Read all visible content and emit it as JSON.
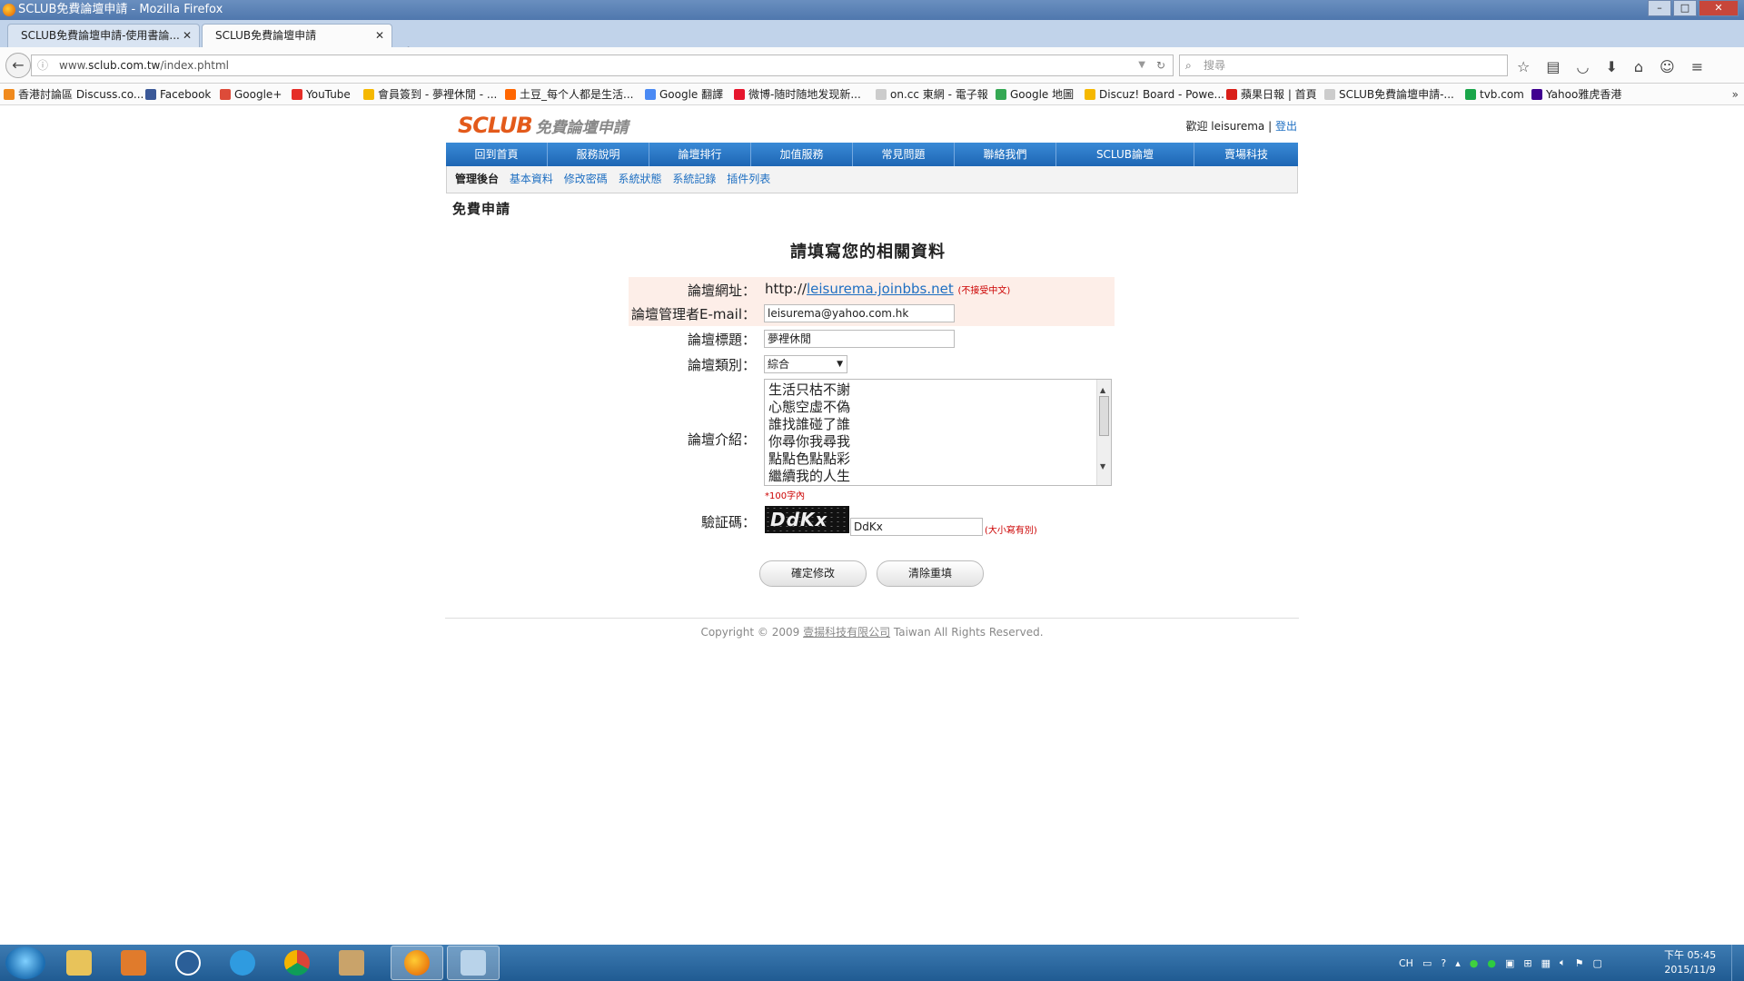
{
  "window": {
    "title": "SCLUB免費論壇申請 - Mozilla Firefox"
  },
  "browser": {
    "tabs": [
      {
        "label": "SCLUB免費論壇申請-使用書論..."
      },
      {
        "label": "SCLUB免費論壇申請"
      }
    ],
    "url_prefix": "www.",
    "url_host": "sclub.com.tw",
    "url_path": "/index.phtml",
    "search_placeholder": "搜尋",
    "bookmarks": [
      {
        "label": "香港討論區 Discuss.co...",
        "color": "#f08a1d"
      },
      {
        "label": "Facebook",
        "color": "#3b5998"
      },
      {
        "label": "Google+",
        "color": "#dd4b39"
      },
      {
        "label": "YouTube",
        "color": "#e52d27"
      },
      {
        "label": "會員簽到 - 夢裡休閒 - ...",
        "color": "#f5b800"
      },
      {
        "label": "土豆_每个人都是生活...",
        "color": "#ff6600"
      },
      {
        "label": "Google 翻譯",
        "color": "#4a8af4"
      },
      {
        "label": "微博-随时随地发现新...",
        "color": "#e6162d"
      },
      {
        "label": "on.cc 東網 - 電子報",
        "color": "#cccccc"
      },
      {
        "label": "Google 地圖",
        "color": "#34a853"
      },
      {
        "label": "Discuz! Board - Powe...",
        "color": "#f5b800"
      },
      {
        "label": "蘋果日報 | 首頁",
        "color": "#d91e18"
      },
      {
        "label": "SCLUB免費論壇申請-...",
        "color": "#cccccc"
      },
      {
        "label": "tvb.com",
        "color": "#1aa64a"
      },
      {
        "label": "Yahoo雅虎香港",
        "color": "#400090"
      }
    ]
  },
  "site": {
    "logo": "SCLUB",
    "logo_sub": "免費論壇申請",
    "welcome": "歡迎 leisurema |",
    "logout": "登出",
    "nav": [
      "回到首頁",
      "服務說明",
      "論壇排行",
      "加值服務",
      "常見問題",
      "聯絡我們",
      "SCLUB論壇",
      "賣場科技"
    ],
    "subnav_current": "管理後台",
    "subnav": [
      "基本資料",
      "修改密碼",
      "系統狀態",
      "系統記錄",
      "插件列表"
    ],
    "page_heading": "免費申請"
  },
  "form": {
    "title": "請填寫您的相關資料",
    "url_label": "論壇網址：",
    "url_prefix": "http://",
    "url_value": "leisurema.joinbbs.net",
    "url_note": "(不接受中文)",
    "email_label": "論壇管理者E-mail：",
    "email_value": "leisurema@yahoo.com.hk",
    "forum_title_label": "論壇標題：",
    "forum_title_value": "夢裡休閒",
    "category_label": "論壇類別：",
    "category_value": "綜合",
    "intro_label": "論壇介紹：",
    "intro_lines": [
      "生活只枯不謝",
      "心態空虛不偽",
      "誰找誰碰了誰",
      "你尋你我尋我",
      "點點色點點彩",
      "繼續我的人生"
    ],
    "intro_note": "*100字內",
    "captcha_label": "驗証碼：",
    "captcha_image_text": "DdKx",
    "captcha_value": "DdKx",
    "captcha_note": "(大小寫有別)",
    "submit": "確定修改",
    "reset": "清除重填"
  },
  "footer": {
    "before": "Copyright © 2009 ",
    "company": "壹揚科技有限公司",
    "after": " Taiwan All Rights Reserved."
  },
  "taskbar": {
    "tray_lang": "CH",
    "time": "下午 05:45",
    "date": "2015/11/9"
  }
}
